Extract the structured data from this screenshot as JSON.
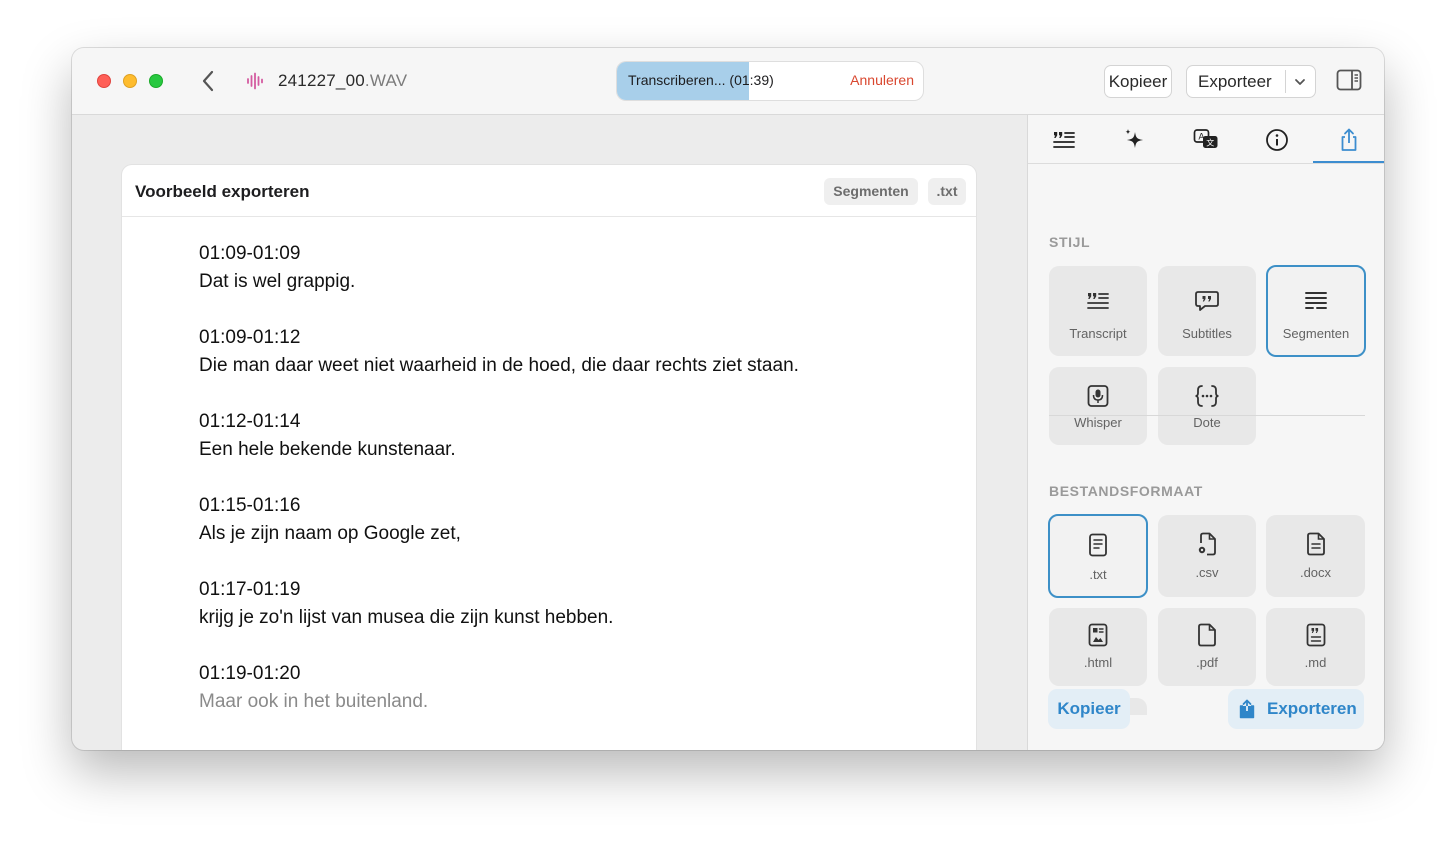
{
  "titlebar": {
    "file_name": "241227_00",
    "file_ext": ".WAV",
    "progress_text": "Transcriberen... (01:39)",
    "progress_fraction": 0.43,
    "cancel_label": "Annuleren",
    "copy_label": "Kopieer",
    "export_label": "Exporteer"
  },
  "preview": {
    "title": "Voorbeeld exporteren",
    "chip_style": "Segmenten",
    "chip_format": ".txt",
    "segments": [
      {
        "time": "01:09-01:09",
        "text": "Dat is wel grappig."
      },
      {
        "time": "01:09-01:12",
        "text": "Die man daar weet niet waarheid in de hoed, die daar rechts ziet staan."
      },
      {
        "time": "01:12-01:14",
        "text": "Een hele bekende kunstenaar."
      },
      {
        "time": "01:15-01:16",
        "text": "Als je zijn naam op Google zet,"
      },
      {
        "time": "01:17-01:19",
        "text": "krijg je zo'n lijst van musea die zijn kunst hebben."
      },
      {
        "time": "01:19-01:20",
        "text": "Maar ook in het buitenland."
      }
    ]
  },
  "panel": {
    "tabs": [
      "transcript-tab",
      "ai-tab",
      "translate-tab",
      "info-tab",
      "export-tab"
    ],
    "style_section": "STIJL",
    "styles": [
      {
        "label": "Transcript",
        "icon": "quote-lines-icon"
      },
      {
        "label": "Subtitles",
        "icon": "speech-bubble-icon"
      },
      {
        "label": "Segmenten",
        "icon": "segments-icon"
      },
      {
        "label": "Whisper",
        "icon": "microphone-icon"
      },
      {
        "label": "Dote",
        "icon": "braces-icon"
      }
    ],
    "format_section": "BESTANDSFORMAAT",
    "formats": [
      {
        "label": ".txt",
        "icon": "text-doc-icon"
      },
      {
        "label": ".csv",
        "icon": "csv-doc-icon"
      },
      {
        "label": ".docx",
        "icon": "docx-doc-icon"
      },
      {
        "label": ".html",
        "icon": "html-doc-icon"
      },
      {
        "label": ".pdf",
        "icon": "pdf-doc-icon"
      },
      {
        "label": ".md",
        "icon": "md-doc-icon"
      }
    ],
    "copy_label": "Kopieer",
    "export_label": "Exporteren"
  },
  "colors": {
    "accent": "#3d90c7",
    "progress_fill": "#a8cfea",
    "cancel": "#d9472f",
    "waveform": "#d45aa0"
  }
}
